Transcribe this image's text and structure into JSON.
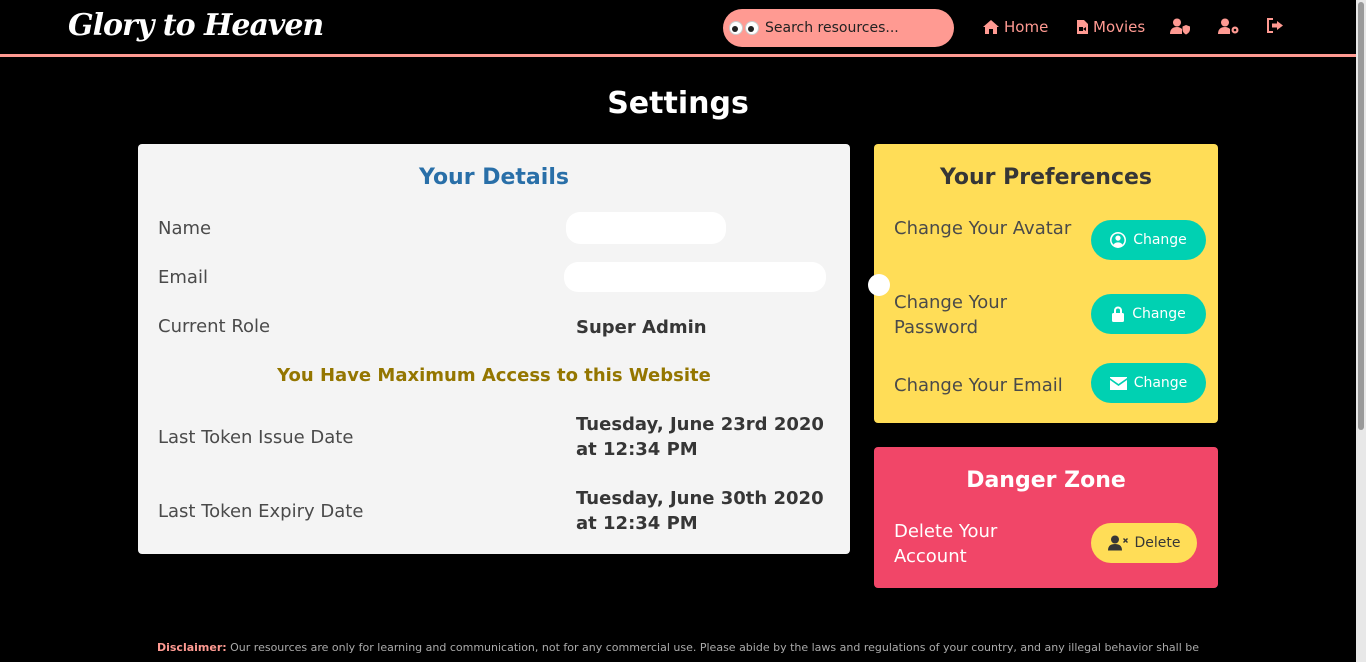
{
  "brand": "Glory to Heaven",
  "search": {
    "placeholder": "Search resources..."
  },
  "nav": {
    "home": "Home",
    "movies": "Movies"
  },
  "page_title": "Settings",
  "details": {
    "title": "Your Details",
    "name_label": "Name",
    "email_label": "Email",
    "role_label": "Current Role",
    "role_value": "Super Admin",
    "access_note": "You Have Maximum Access to this Website",
    "issue_label": "Last Token Issue Date",
    "issue_value": "Tuesday, June 23rd 2020 at 12:34 PM",
    "expiry_label": "Last Token Expiry Date",
    "expiry_value": "Tuesday, June 30th 2020 at 12:34 PM"
  },
  "preferences": {
    "title": "Your Preferences",
    "avatar_label": "Change Your Avatar",
    "password_label": "Change Your Password",
    "email_label": "Change Your Email",
    "button_label": "Change"
  },
  "danger": {
    "title": "Danger Zone",
    "delete_label": "Delete Your Account",
    "delete_button": "Delete"
  },
  "footer": {
    "strong": "Disclaimer:",
    "text": " Our resources are only for learning and communication, not for any commercial use. Please abide by the laws and regulations of your country, and any illegal behavior shall be"
  },
  "colors": {
    "accent": "#ff9a92",
    "details_title": "#296fa8",
    "access_note": "#947600",
    "preferences_bg": "#ffdd57",
    "button_teal": "#00d1b2",
    "danger_bg": "#f14668"
  }
}
